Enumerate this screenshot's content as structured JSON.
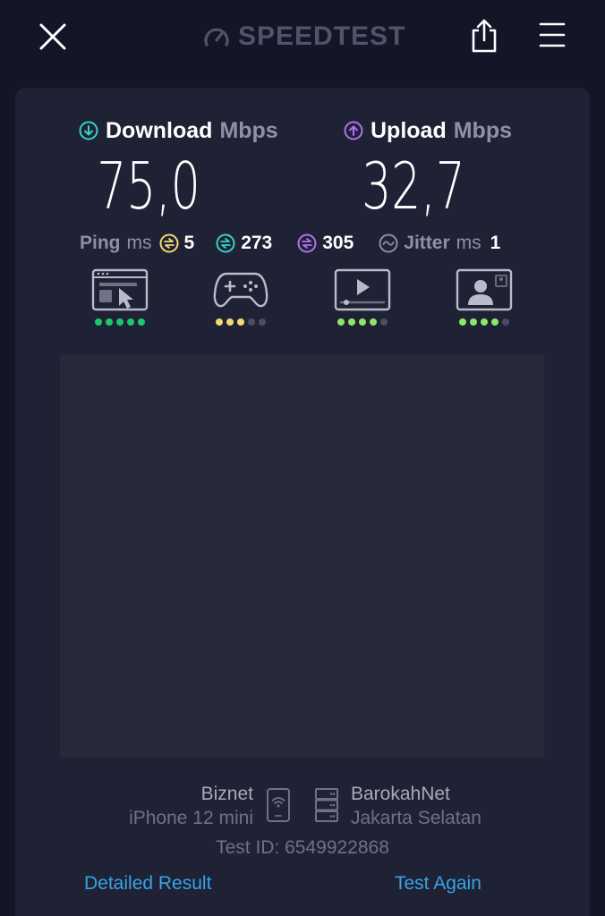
{
  "header": {
    "brand_name": "SPEEDTEST",
    "close_icon": "close-icon",
    "share_icon": "share-icon",
    "menu_icon": "hamburger-menu-icon"
  },
  "results": {
    "download": {
      "label": "Download",
      "unit": "Mbps",
      "value": "75,0",
      "icon": "arrow-down-circle-icon",
      "color": "#35d3c4"
    },
    "upload": {
      "label": "Upload",
      "unit": "Mbps",
      "value": "32,7",
      "icon": "arrow-up-circle-icon",
      "color": "#b56ef5"
    }
  },
  "latency": {
    "ping_label": "Ping",
    "ping_unit": "ms",
    "idle": {
      "value": "5",
      "color": "#f2d970"
    },
    "download": {
      "value": "273",
      "color": "#35d3c4"
    },
    "upload": {
      "value": "305",
      "color": "#b56ef5"
    },
    "jitter_label": "Jitter",
    "jitter_unit": "ms",
    "jitter_value": "1"
  },
  "quality_ratings": [
    {
      "name": "web-browsing",
      "icon": "browser-cursor-icon",
      "rating": 5,
      "max": 5,
      "color": "#1fc76a"
    },
    {
      "name": "gaming",
      "icon": "gamepad-icon",
      "rating": 3,
      "max": 5,
      "color": "#f2d970"
    },
    {
      "name": "video-streaming",
      "icon": "video-player-icon",
      "rating": 4,
      "max": 5,
      "color": "#8ee868"
    },
    {
      "name": "video-chat",
      "icon": "video-call-icon",
      "rating": 4,
      "max": 5,
      "color": "#8ee868"
    }
  ],
  "connection": {
    "isp": "Biznet",
    "device": "iPhone 12 mini",
    "server_name": "BarokahNet",
    "server_location": "Jakarta Selatan",
    "test_id": "Test ID: 6549922868"
  },
  "actions": {
    "detailed_result": "Detailed Result",
    "test_again": "Test Again"
  },
  "colors": {
    "background": "#141526",
    "card": "#1f2134",
    "link": "#37a4e8"
  }
}
